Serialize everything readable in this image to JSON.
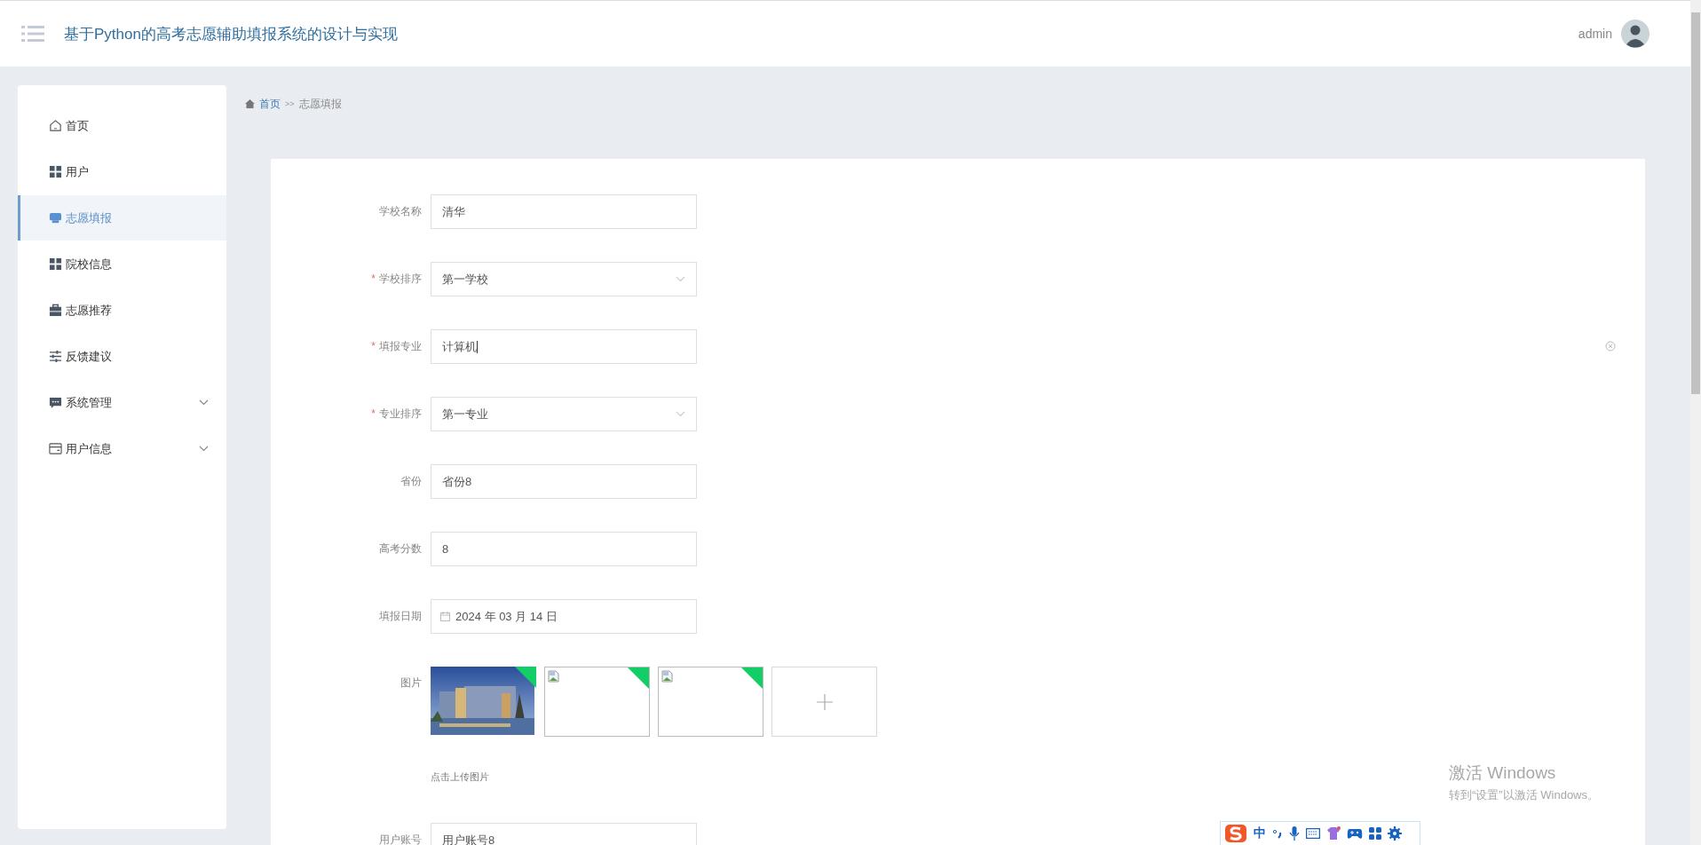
{
  "header": {
    "title": "基于Python的高考志愿辅助填报系统的设计与实现",
    "user": "admin"
  },
  "sidebar": {
    "items": [
      {
        "label": "首页",
        "selected": false,
        "expandable": false
      },
      {
        "label": "用户",
        "selected": false,
        "expandable": false
      },
      {
        "label": "志愿填报",
        "selected": true,
        "expandable": false
      },
      {
        "label": "院校信息",
        "selected": false,
        "expandable": false
      },
      {
        "label": "志愿推荐",
        "selected": false,
        "expandable": false
      },
      {
        "label": "反馈建议",
        "selected": false,
        "expandable": false
      },
      {
        "label": "系统管理",
        "selected": false,
        "expandable": true
      },
      {
        "label": "用户信息",
        "selected": false,
        "expandable": true
      }
    ]
  },
  "breadcrumb": {
    "home": "首页",
    "separator": ">>",
    "current": "志愿填报"
  },
  "form": {
    "rows": [
      {
        "kind": "text",
        "label": "学校名称",
        "value": "清华",
        "focused": false
      },
      {
        "kind": "select",
        "label": "学校排序",
        "required_mark": "*",
        "value": "第一学校"
      },
      {
        "kind": "text",
        "label": "填报专业",
        "required_mark": "*",
        "value": "计算机",
        "focused": true
      },
      {
        "kind": "select",
        "label": "专业排序",
        "required_mark": "*",
        "value": "第一专业"
      },
      {
        "kind": "text",
        "label": "省份",
        "value": "省份8",
        "focused": false
      },
      {
        "kind": "text",
        "label": "高考分数",
        "value": "8",
        "focused": false
      },
      {
        "kind": "date",
        "label": "填报日期",
        "value": "2024 年 03 月 14 日"
      },
      {
        "kind": "upload",
        "label": "图片",
        "hint": "点击上传图片",
        "images": [
          {
            "kind": "picture",
            "uploaded": true
          },
          {
            "kind": "broken",
            "uploaded": true
          },
          {
            "kind": "broken",
            "uploaded": true
          }
        ]
      },
      {
        "kind": "text",
        "label": "用户账号",
        "value": "用户账号8",
        "focused": false
      }
    ]
  },
  "os_overlay": {
    "title": "激活 Windows",
    "subtitle": "转到“设置”以激活 Windows。"
  },
  "ime_toolbar": {
    "mode": "中"
  }
}
